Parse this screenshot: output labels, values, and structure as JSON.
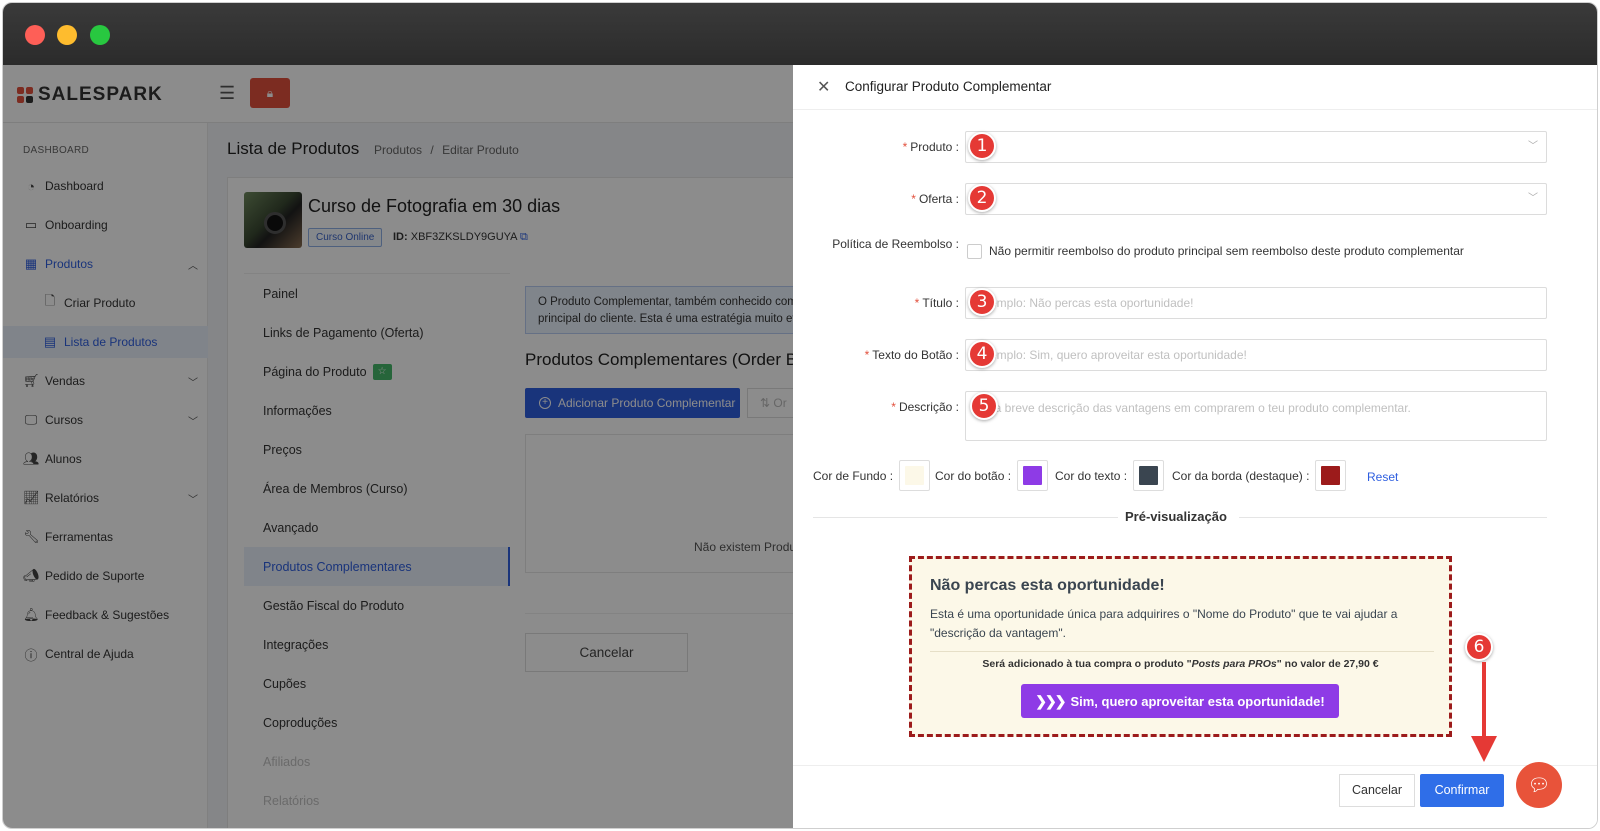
{
  "brand": {
    "name": "SALESPARK"
  },
  "sidebar": {
    "section": "DASHBOARD",
    "items": [
      {
        "label": "Dashboard",
        "icon": "dashboard-icon"
      },
      {
        "label": "Onboarding",
        "icon": "onboarding-icon"
      },
      {
        "label": "Produtos",
        "icon": "grid-icon"
      },
      {
        "label": "Criar Produto",
        "icon": "file-plus-icon"
      },
      {
        "label": "Lista de Produtos",
        "icon": "table-icon"
      },
      {
        "label": "Vendas",
        "icon": "cart-icon"
      },
      {
        "label": "Cursos",
        "icon": "monitor-icon"
      },
      {
        "label": "Alunos",
        "icon": "users-icon"
      },
      {
        "label": "Relatórios",
        "icon": "chart-icon"
      },
      {
        "label": "Ferramentas",
        "icon": "tool-icon"
      },
      {
        "label": "Pedido de Suporte",
        "icon": "megaphone-icon"
      },
      {
        "label": "Feedback & Sugestões",
        "icon": "bell-icon"
      },
      {
        "label": "Central de Ajuda",
        "icon": "help-icon"
      }
    ]
  },
  "page": {
    "title": "Lista de Produtos",
    "breadcrumb": [
      "Produtos",
      "/",
      "Editar Produto"
    ]
  },
  "product": {
    "name": "Curso de Fotografia em 30 dias",
    "tag": "Curso Online",
    "id_label": "ID:",
    "id_value": "XBF3ZKSLDY9GUYA"
  },
  "product_nav": [
    "Painel",
    "Links de Pagamento (Oferta)",
    "Página do Produto",
    "Informações",
    "Preços",
    "Área de Membros (Curso)",
    "Avançado",
    "Produtos Complementares",
    "Gestão Fiscal do Produto",
    "Integrações",
    "Cupões",
    "Coproduções",
    "Afiliados",
    "Relatórios"
  ],
  "main_content": {
    "info_line1": "O Produto Complementar, também conhecido com",
    "info_line2": "principal do cliente. Esta é uma estratégia muito ef",
    "section_title": "Produtos Complementares (Order B",
    "add_button": "Adicionar Produto Complementar",
    "ghost_button": "Or",
    "empty_text": "Não existem Produt",
    "cancel_button": "Cancelar"
  },
  "drawer": {
    "title": "Configurar Produto Complementar",
    "fields": {
      "produto_label": "Produto",
      "oferta_label": "Oferta",
      "politica_label": "Política de Reembolso",
      "politica_checkbox": "Não permitir reembolso do produto principal sem reembolso deste produto complementar",
      "titulo_label": "Título",
      "titulo_placeholder": "Exemplo: Não percas esta oportunidade!",
      "botao_label": "Texto do Botão",
      "botao_placeholder": "Exemplo: Sim, quero aproveitar esta oportunidade!",
      "descricao_label": "Descrição",
      "descricao_placeholder": "Uma breve descrição das vantagens em comprarem o teu produto complementar."
    },
    "colors": {
      "fundo_label": "Cor de Fundo",
      "fundo_value": "#fcf8e8",
      "botao_label": "Cor do botão",
      "botao_value": "#8e3be6",
      "texto_label": "Cor do texto",
      "texto_value": "#3a4550",
      "borda_label": "Cor da borda (destaque)",
      "borda_value": "#9c1b1b",
      "reset": "Reset"
    },
    "preview": {
      "heading": "Pré-visualização",
      "title": "Não percas esta oportunidade!",
      "desc": "Esta é uma oportunidade única para adquirires o \"Nome do Produto\" que te vai ajudar a \"descrição da vantagem\".",
      "note_prefix": "Será adicionado à tua compra o produto \"",
      "note_product": "Posts para PROs",
      "note_suffix": "\" no valor de 27,90 €",
      "button": "Sim, quero aproveitar esta oportunidade!"
    },
    "footer": {
      "cancel": "Cancelar",
      "confirm": "Confirmar"
    }
  },
  "annotations": [
    "1",
    "2",
    "3",
    "4",
    "5",
    "6"
  ]
}
